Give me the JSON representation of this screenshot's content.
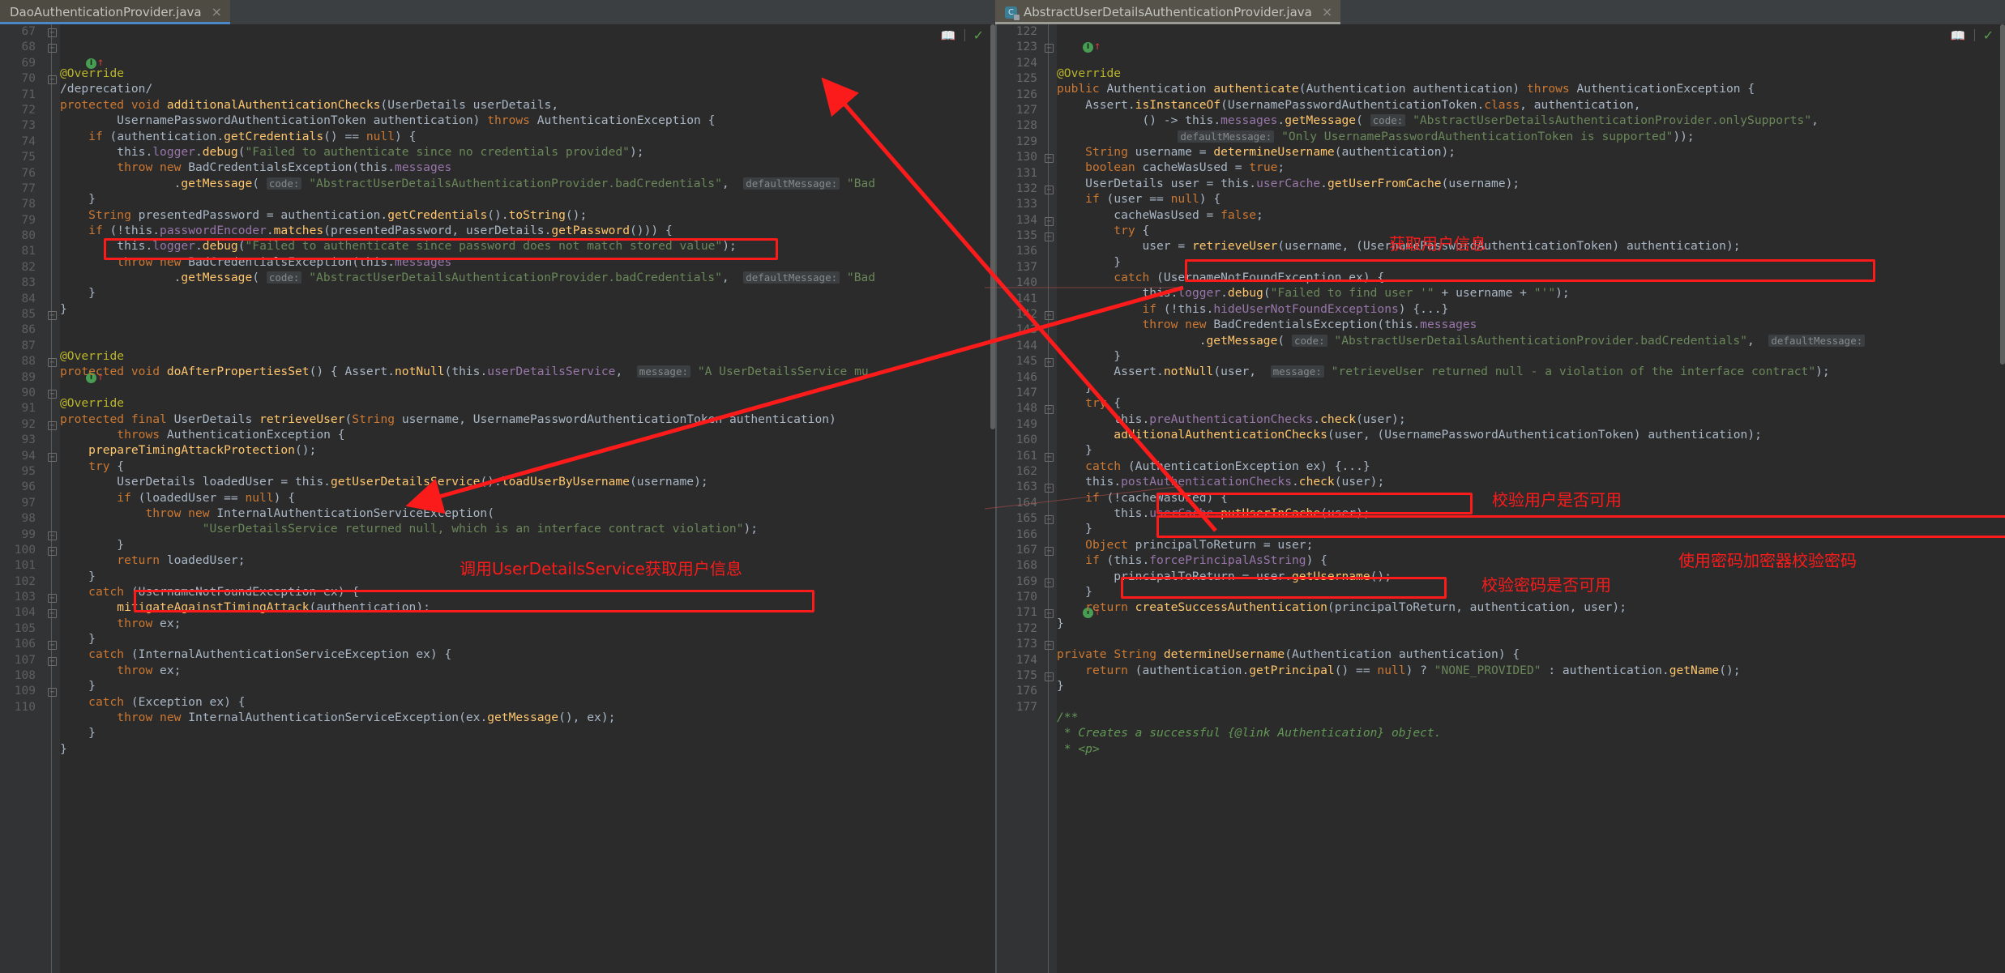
{
  "window": {
    "theme_bg": "#2b2b2b",
    "gutter_bg": "#313335",
    "tabbar_bg": "#3c3f41",
    "accent": "#4a88c7",
    "annotation_color": "#fb1b1b"
  },
  "tabs": {
    "left": {
      "label": "DaoAuthenticationProvider.java",
      "close": "×",
      "active": true
    },
    "right": {
      "label": "AbstractUserDetailsAuthenticationProvider.java",
      "close": "×",
      "active": true,
      "icon": "java-class-icon"
    }
  },
  "widgets": {
    "reader_mode": "book-icon",
    "inspection_status": "checkmark-icon"
  },
  "left_pane": {
    "first_line_number": 67,
    "lines": [
      {
        "n": 67,
        "text": "@Override"
      },
      {
        "n": 68,
        "text": "/deprecation/"
      },
      {
        "n": 69,
        "text": "protected void additionalAuthenticationChecks(UserDetails userDetails,"
      },
      {
        "n": 70,
        "text": "        UsernamePasswordAuthenticationToken authentication) throws AuthenticationException {"
      },
      {
        "n": 71,
        "text": "    if (authentication.getCredentials() == null) {"
      },
      {
        "n": 72,
        "text": "        this.logger.debug(\"Failed to authenticate since no credentials provided\");"
      },
      {
        "n": 73,
        "text": "        throw new BadCredentialsException(this.messages"
      },
      {
        "n": 74,
        "text": "                .getMessage( code: \"AbstractUserDetailsAuthenticationProvider.badCredentials\",  defaultMessage: \"Bad"
      },
      {
        "n": 75,
        "text": "    }"
      },
      {
        "n": 76,
        "text": "    String presentedPassword = authentication.getCredentials().toString();"
      },
      {
        "n": 77,
        "text": "    if (!this.passwordEncoder.matches(presentedPassword, userDetails.getPassword())) {"
      },
      {
        "n": 78,
        "text": "        this.logger.debug(\"Failed to authenticate since password does not match stored value\");"
      },
      {
        "n": 79,
        "text": "        throw new BadCredentialsException(this.messages"
      },
      {
        "n": 80,
        "text": "                .getMessage( code: \"AbstractUserDetailsAuthenticationProvider.badCredentials\",  defaultMessage: \"Bad"
      },
      {
        "n": 81,
        "text": "    }"
      },
      {
        "n": 82,
        "text": "}"
      },
      {
        "n": 83,
        "text": ""
      },
      {
        "n": 84,
        "text": ""
      },
      {
        "n": 85,
        "text": "@Override"
      },
      {
        "n": 86,
        "text": "protected void doAfterPropertiesSet() { Assert.notNull(this.userDetailsService,  message: \"A UserDetailsService mu"
      },
      {
        "n": 87,
        "text": ""
      },
      {
        "n": 88,
        "text": "@Override"
      },
      {
        "n": 89,
        "text": "protected final UserDetails retrieveUser(String username, UsernamePasswordAuthenticationToken authentication)"
      },
      {
        "n": 90,
        "text": "        throws AuthenticationException {"
      },
      {
        "n": 91,
        "text": "    prepareTimingAttackProtection();"
      },
      {
        "n": 92,
        "text": "    try {"
      },
      {
        "n": 93,
        "text": "        UserDetails loadedUser = this.getUserDetailsService().loadUserByUsername(username);"
      },
      {
        "n": 94,
        "text": "        if (loadedUser == null) {"
      },
      {
        "n": 95,
        "text": "            throw new InternalAuthenticationServiceException("
      },
      {
        "n": 96,
        "text": "                    \"UserDetailsService returned null, which is an interface contract violation\");"
      },
      {
        "n": 97,
        "text": "        }"
      },
      {
        "n": 98,
        "text": "        return loadedUser;"
      },
      {
        "n": 99,
        "text": "    }"
      },
      {
        "n": 100,
        "text": "    catch (UsernameNotFoundException ex) {"
      },
      {
        "n": 101,
        "text": "        mitigateAgainstTimingAttack(authentication);"
      },
      {
        "n": 102,
        "text": "        throw ex;"
      },
      {
        "n": 103,
        "text": "    }"
      },
      {
        "n": 104,
        "text": "    catch (InternalAuthenticationServiceException ex) {"
      },
      {
        "n": 105,
        "text": "        throw ex;"
      },
      {
        "n": 106,
        "text": "    }"
      },
      {
        "n": 107,
        "text": "    catch (Exception ex) {"
      },
      {
        "n": 108,
        "text": "        throw new InternalAuthenticationServiceException(ex.getMessage(), ex);"
      },
      {
        "n": 109,
        "text": "    }"
      },
      {
        "n": 110,
        "text": "}"
      }
    ],
    "annotations": [
      {
        "label": "调用UserDetailsService获取用户信息",
        "kind": "callout-label"
      }
    ]
  },
  "right_pane": {
    "lines": [
      {
        "n": 122,
        "text": "@Override"
      },
      {
        "n": 123,
        "text": "public Authentication authenticate(Authentication authentication) throws AuthenticationException {"
      },
      {
        "n": 124,
        "text": "    Assert.isInstanceOf(UsernamePasswordAuthenticationToken.class, authentication,"
      },
      {
        "n": 125,
        "text": "            () -> this.messages.getMessage( code: \"AbstractUserDetailsAuthenticationProvider.onlySupports\","
      },
      {
        "n": 126,
        "text": "                 defaultMessage: \"Only UsernamePasswordAuthenticationToken is supported\"));"
      },
      {
        "n": 127,
        "text": "    String username = determineUsername(authentication);"
      },
      {
        "n": 128,
        "text": "    boolean cacheWasUsed = true;"
      },
      {
        "n": 129,
        "text": "    UserDetails user = this.userCache.getUserFromCache(username);"
      },
      {
        "n": 130,
        "text": "    if (user == null) {"
      },
      {
        "n": 131,
        "text": "        cacheWasUsed = false;"
      },
      {
        "n": 132,
        "text": "        try {"
      },
      {
        "n": 133,
        "text": "            user = retrieveUser(username, (UsernamePasswordAuthenticationToken) authentication);"
      },
      {
        "n": 134,
        "text": "        }"
      },
      {
        "n": 135,
        "text": "        catch (UsernameNotFoundException ex) {"
      },
      {
        "n": 136,
        "text": "            this.logger.debug(\"Failed to find user '\" + username + \"'\");"
      },
      {
        "n": 137,
        "text": "            if (!this.hideUserNotFoundExceptions) {...}"
      },
      {
        "n": 140,
        "text": "            throw new BadCredentialsException(this.messages"
      },
      {
        "n": 141,
        "text": "                    .getMessage( code: \"AbstractUserDetailsAuthenticationProvider.badCredentials\",  defaultMessage:"
      },
      {
        "n": 142,
        "text": "        }"
      },
      {
        "n": 143,
        "text": "        Assert.notNull(user,  message: \"retrieveUser returned null - a violation of the interface contract\");"
      },
      {
        "n": 144,
        "text": "    }"
      },
      {
        "n": 145,
        "text": "    try {"
      },
      {
        "n": 146,
        "text": "        this.preAuthenticationChecks.check(user);"
      },
      {
        "n": 147,
        "text": "        additionalAuthenticationChecks(user, (UsernamePasswordAuthenticationToken) authentication);"
      },
      {
        "n": 148,
        "text": "    }"
      },
      {
        "n": 149,
        "text": "    catch (AuthenticationException ex) {...}"
      },
      {
        "n": 160,
        "text": "    this.postAuthenticationChecks.check(user);"
      },
      {
        "n": 161,
        "text": "    if (!cacheWasUsed) {"
      },
      {
        "n": 162,
        "text": "        this.userCache.putUserInCache(user);"
      },
      {
        "n": 163,
        "text": "    }"
      },
      {
        "n": 164,
        "text": "    Object principalToReturn = user;"
      },
      {
        "n": 165,
        "text": "    if (this.forcePrincipalAsString) {"
      },
      {
        "n": 166,
        "text": "        principalToReturn = user.getUsername();"
      },
      {
        "n": 167,
        "text": "    }"
      },
      {
        "n": 168,
        "text": "    return createSuccessAuthentication(principalToReturn, authentication, user);"
      },
      {
        "n": 169,
        "text": "}"
      },
      {
        "n": 170,
        "text": ""
      },
      {
        "n": 171,
        "text": "private String determineUsername(Authentication authentication) {"
      },
      {
        "n": 172,
        "text": "    return (authentication.getPrincipal() == null) ? \"NONE_PROVIDED\" : authentication.getName();"
      },
      {
        "n": 173,
        "text": "}"
      },
      {
        "n": 174,
        "text": ""
      },
      {
        "n": 175,
        "text": "/**"
      },
      {
        "n": 176,
        "text": " * Creates a successful {@link Authentication} object."
      },
      {
        "n": 177,
        "text": " * <p>"
      }
    ],
    "annotations": [
      {
        "label": "获取用户信息",
        "kind": "callout-label"
      },
      {
        "label": "校验用户是否可用",
        "kind": "callout-label"
      },
      {
        "label": "使用密码加密器校验密码",
        "kind": "callout-label"
      },
      {
        "label": "校验密码是否可用",
        "kind": "callout-label"
      }
    ]
  }
}
